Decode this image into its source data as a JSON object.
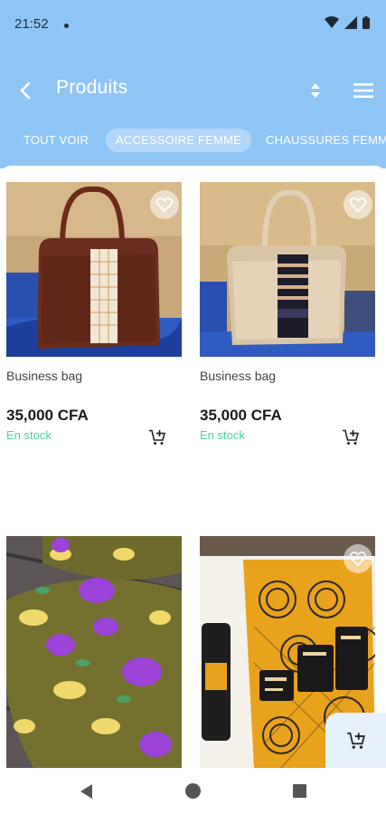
{
  "status_bar": {
    "time": "21:52"
  },
  "header": {
    "title": "Produits",
    "back_icon": "chevron-left-icon",
    "sort_icon": "sort-icon",
    "menu_icon": "hamburger-menu-icon"
  },
  "tabs": [
    {
      "label": "TOUT VOIR",
      "active": false
    },
    {
      "label": "ACCESSOIRE FEMME",
      "active": true
    },
    {
      "label": "CHAUSSURES FEMME",
      "active": false
    }
  ],
  "products": [
    {
      "name": "Business bag",
      "price": "35,000 CFA",
      "stock": "En stock"
    },
    {
      "name": "Business bag",
      "price": "35,000 CFA",
      "stock": "En stock"
    },
    {
      "name": "",
      "price": "",
      "stock": ""
    },
    {
      "name": "",
      "price": "",
      "stock": ""
    }
  ],
  "colors": {
    "header_bg": "#8fc5f5",
    "stock_green": "#4cd0a0",
    "fab_bg": "#e6f1fb"
  }
}
